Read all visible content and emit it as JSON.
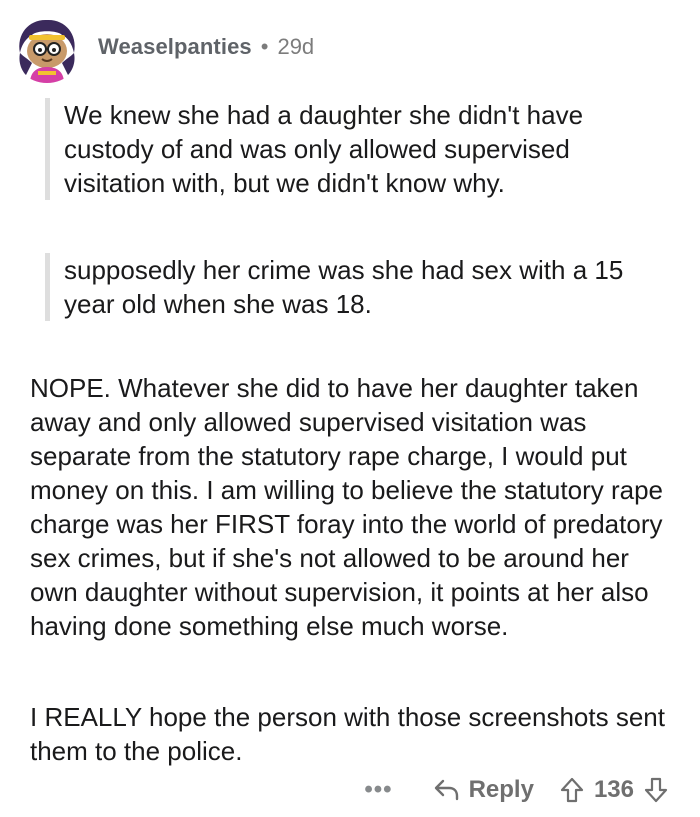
{
  "comment": {
    "username": "Weaselpanties",
    "separator": "•",
    "age": "29d",
    "quote_1": "We knew she had a daughter she didn't have custody of and was only allowed supervised visitation with, but we didn't know why.",
    "quote_2": "supposedly her crime was she had sex with a 15 year old when she was 18.",
    "paragraph_1": "NOPE. Whatever she did to have her daughter taken away and only allowed supervised visitation was separate from the statutory rape charge, I would put money on this. I am willing to believe the statutory rape charge was her FIRST foray into the world of predatory sex crimes, but if she's not allowed to be around her own daughter without supervision, it points at her also having done something else much worse.",
    "paragraph_2": "I REALLY hope the person with those screenshots sent them to the police."
  },
  "actions": {
    "more": "•••",
    "reply_label": "Reply",
    "score": "136"
  },
  "icons": {
    "avatar": "snoo-avatar-icon",
    "reply": "reply-arrow-icon",
    "upvote": "upvote-arrow-icon",
    "downvote": "downvote-arrow-icon"
  },
  "colors": {
    "username": "#5f6368",
    "meta": "#7c7c7c",
    "quote_bar": "#dedede",
    "text": "#1a1a1b",
    "avatar_bg": "#3b2a5c"
  }
}
